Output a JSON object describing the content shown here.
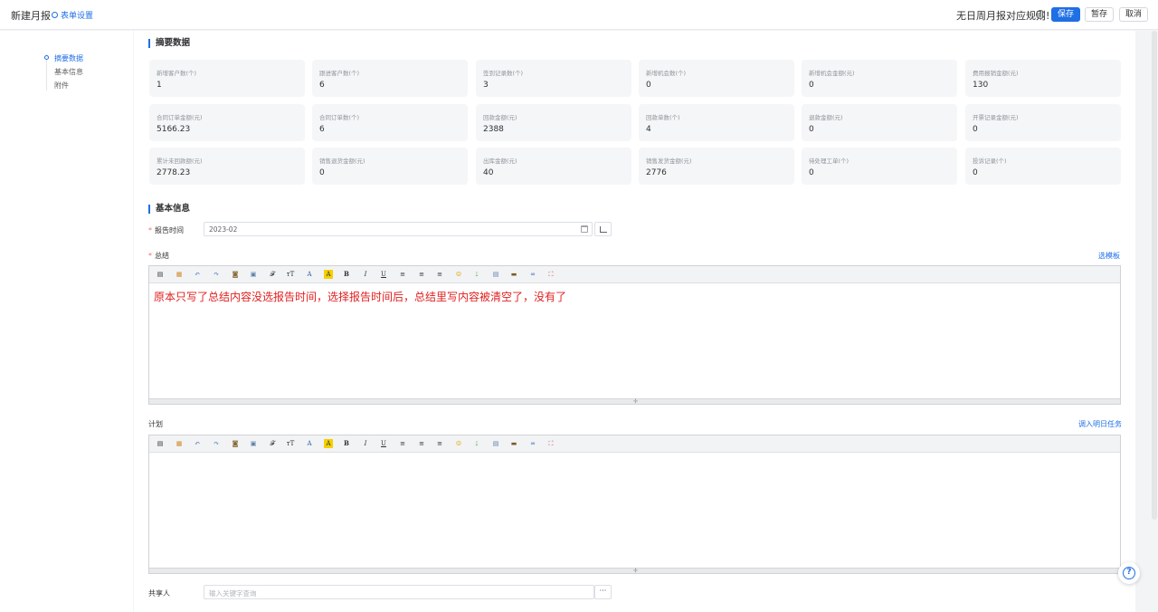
{
  "header": {
    "title": "新建月报",
    "form_settings": "表单设置",
    "rule_message": "无日周月报对应规则!",
    "save_label": "保存",
    "draft_label": "暂存",
    "cancel_label": "取消"
  },
  "sidebar": {
    "items": [
      {
        "label": "摘要数据",
        "active": true
      },
      {
        "label": "基本信息",
        "active": false
      },
      {
        "label": "附件",
        "active": false
      }
    ]
  },
  "summary": {
    "title": "摘要数据",
    "cards": [
      {
        "label": "新增客户数(个)",
        "value": "1"
      },
      {
        "label": "跟进客户数(个)",
        "value": "6"
      },
      {
        "label": "签到记录数(个)",
        "value": "3"
      },
      {
        "label": "新增机会数(个)",
        "value": "0"
      },
      {
        "label": "新增机会金额(元)",
        "value": "0"
      },
      {
        "label": "费用报销金额(元)",
        "value": "130"
      },
      {
        "label": "合同订单金额(元)",
        "value": "5166.23"
      },
      {
        "label": "合同订单数(个)",
        "value": "6"
      },
      {
        "label": "回款金额(元)",
        "value": "2388"
      },
      {
        "label": "回款单数(个)",
        "value": "4"
      },
      {
        "label": "退款金额(元)",
        "value": "0"
      },
      {
        "label": "开票记录金额(元)",
        "value": "0"
      },
      {
        "label": "累计未回款额(元)",
        "value": "2778.23"
      },
      {
        "label": "销售退货金额(元)",
        "value": "0"
      },
      {
        "label": "出库金额(元)",
        "value": "40"
      },
      {
        "label": "销售发货金额(元)",
        "value": "2776"
      },
      {
        "label": "待处理工单(个)",
        "value": "0"
      },
      {
        "label": "投诉记录(个)",
        "value": "0"
      }
    ]
  },
  "basic": {
    "title": "基本信息",
    "report_time_label": "报告时间",
    "report_time_value": "2023-02",
    "summary_label": "总结",
    "select_template": "选模板",
    "summary_content": "原本只写了总结内容没选报告时间，选择报告时间后，总结里写内容被清空了，没有了",
    "plan_label": "计划",
    "import_tasks": "调入明日任务",
    "share_label": "共享人",
    "share_placeholder": "输入关键字查询",
    "more_button": "···"
  },
  "colors": {
    "accent": "#1f6fe5",
    "required": "#f56c6c",
    "editor_text": "#e02020"
  }
}
